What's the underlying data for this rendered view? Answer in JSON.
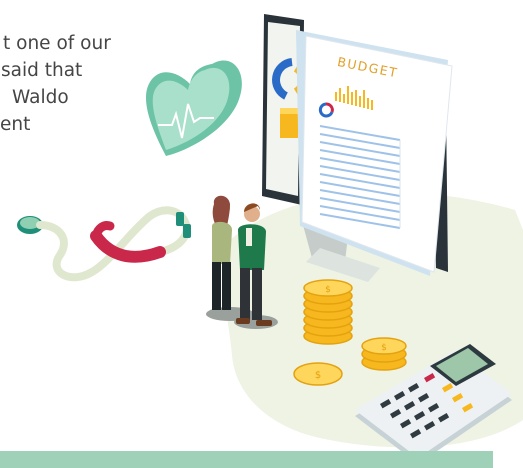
{
  "caption": {
    "line1": "t one of our",
    "line2": "said that",
    "line3": "Waldo",
    "line4": "ent"
  },
  "illustration": {
    "document_title": "BUDGET"
  },
  "colors": {
    "background": "#ffffff",
    "blob": "#eef3e4",
    "accent_green": "#8fd0b2",
    "footer_bar": "#9ed1b8",
    "coin_gold": "#f6b81e",
    "stethoscope_red": "#c9284a",
    "document_blue": "#9fc3e8"
  },
  "icons": [
    "heart-rate-icon",
    "stethoscope-icon",
    "coin-stack-icon",
    "calculator-icon",
    "monitor-icon",
    "budget-document-icon"
  ]
}
